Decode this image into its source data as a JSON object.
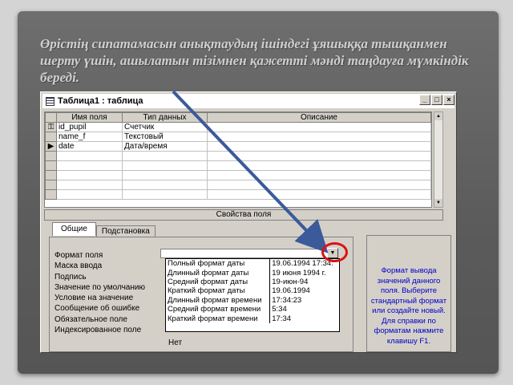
{
  "slide": {
    "caption": "Өрістің сипатамасын анықтаудың ішіндегі ұяшыққа тышқанмен шерту үшін, ашылатын тізімнен қажетті мәнді таңдауға мүмкіндік береді."
  },
  "window": {
    "title": "Таблица1 : таблица",
    "buttons": {
      "minimize": "_",
      "maximize": "□",
      "close": "×"
    }
  },
  "grid": {
    "columns": [
      "Имя поля",
      "Тип данных",
      "Описание"
    ],
    "rows": [
      {
        "marker": "key",
        "name": "id_pupil",
        "type": "Счетчик",
        "desc": ""
      },
      {
        "marker": "",
        "name": "name_f",
        "type": "Текстовый",
        "desc": ""
      },
      {
        "marker": "current",
        "name": "date",
        "type": "Дата/время",
        "desc": ""
      },
      {
        "marker": "",
        "name": "",
        "type": "",
        "desc": ""
      },
      {
        "marker": "",
        "name": "",
        "type": "",
        "desc": ""
      },
      {
        "marker": "",
        "name": "",
        "type": "",
        "desc": ""
      },
      {
        "marker": "",
        "name": "",
        "type": "",
        "desc": ""
      },
      {
        "marker": "",
        "name": "",
        "type": "",
        "desc": ""
      }
    ]
  },
  "properties": {
    "header": "Свойства поля",
    "tabs": [
      "Общие",
      "Подстановка"
    ],
    "labels": [
      "Формат поля",
      "Маска ввода",
      "Подпись",
      "Значение по умолчанию",
      "Условие на значение",
      "Сообщение об ошибке",
      "Обязательное поле",
      "Индексированное поле"
    ],
    "indexed_value_partial": "Нет",
    "dropdown": [
      {
        "name": "Полный формат даты",
        "example": "19.06.1994 17:34:"
      },
      {
        "name": "Длинный формат даты",
        "example": "19 июня 1994 г."
      },
      {
        "name": "Средний формат даты",
        "example": "19-июн-94"
      },
      {
        "name": "Краткий формат даты",
        "example": "19.06.1994"
      },
      {
        "name": "Длинный формат времени",
        "example": "17:34:23"
      },
      {
        "name": "Средний формат времени",
        "example": "5:34"
      },
      {
        "name": "Краткий формат времени",
        "example": "17:34"
      }
    ]
  },
  "help": {
    "text": "Формат вывода значений данного поля. Выберите стандартный формат или создайте новый. Для справки по форматам нажмите клавишу F1."
  },
  "colors": {
    "help_text": "#0000c8",
    "highlight_circle": "#dd1111",
    "arrow": "#3a5a9a"
  }
}
